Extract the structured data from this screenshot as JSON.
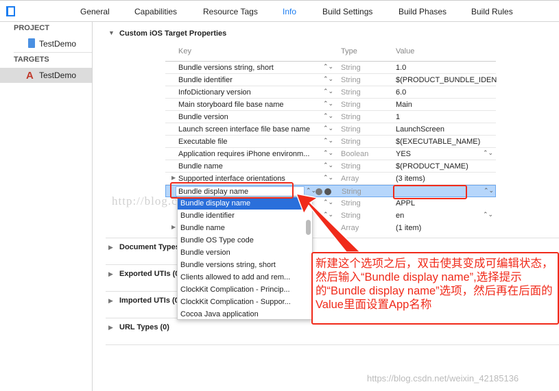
{
  "tabs": [
    "General",
    "Capabilities",
    "Resource Tags",
    "Info",
    "Build Settings",
    "Build Phases",
    "Build Rules"
  ],
  "active_tab": "Info",
  "sidebar": {
    "project_header": "PROJECT",
    "project": "TestDemo",
    "targets_header": "TARGETS",
    "target": "TestDemo"
  },
  "section_title": "Custom iOS Target Properties",
  "columns": {
    "key": "Key",
    "type": "Type",
    "value": "Value"
  },
  "rows": [
    {
      "key": "Bundle versions string, short",
      "type": "String",
      "value": "1.0"
    },
    {
      "key": "Bundle identifier",
      "type": "String",
      "value": "$(PRODUCT_BUNDLE_IDEN"
    },
    {
      "key": "InfoDictionary version",
      "type": "String",
      "value": "6.0"
    },
    {
      "key": "Main storyboard file base name",
      "type": "String",
      "value": "Main"
    },
    {
      "key": "Bundle version",
      "type": "String",
      "value": "1"
    },
    {
      "key": "Launch screen interface file base name",
      "type": "String",
      "value": "LaunchScreen"
    },
    {
      "key": "Executable file",
      "type": "String",
      "value": "$(EXECUTABLE_NAME)"
    },
    {
      "key": "Application requires iPhone environm...",
      "type": "Boolean",
      "value": "YES"
    },
    {
      "key": "Bundle name",
      "type": "String",
      "value": "$(PRODUCT_NAME)"
    },
    {
      "key": "Supported interface orientations",
      "type": "Array",
      "value": "(3 items)"
    }
  ],
  "editing_row": {
    "key": "Bundle display name",
    "type": "String",
    "value": ""
  },
  "after_rows": [
    {
      "type": "String",
      "value": "APPL"
    },
    {
      "type": "String",
      "value": "en"
    },
    {
      "type": "Array",
      "value": "(1 item)"
    }
  ],
  "dropdown": [
    "Bundle display name",
    "Bundle identifier",
    "Bundle name",
    "Bundle OS Type code",
    "Bundle version",
    "Bundle versions string, short",
    "Clients allowed to add and rem...",
    "ClockKit Complication - Princip...",
    "ClockKit Complication - Suppor...",
    "Cocoa Java application"
  ],
  "sections": [
    "Document Types (0)",
    "Exported UTIs (0)",
    "Imported UTIs (0)",
    "URL Types (0)"
  ],
  "note": "新建这个选项之后，双击使其变成可编辑状态，然后输入“Bundle display name”,选择提示的“Bundle display name”选项，然后再在后面的Value里面设置App名称",
  "watermark1": "http://blog.csdn.net/CC1991_",
  "watermark2": "https://blog.csdn.net/weixin_42185136",
  "colors": {
    "accent": "#1a7cf0",
    "annotation": "#f02a1a",
    "selection": "#2a6fdb"
  }
}
